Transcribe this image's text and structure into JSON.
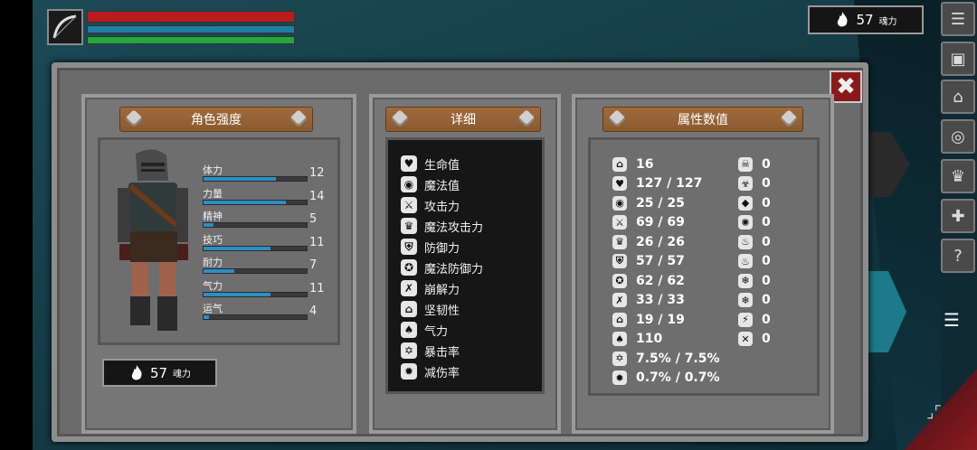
{
  "hud": {
    "souls_top": "57",
    "souls_label": "魂力"
  },
  "panel": {
    "character": {
      "title": "角色强度",
      "stats": [
        {
          "name": "体力",
          "value": "12",
          "fill": 0.7
        },
        {
          "name": "力量",
          "value": "14",
          "fill": 0.8
        },
        {
          "name": "精神",
          "value": "5",
          "fill": 0.1
        },
        {
          "name": "技巧",
          "value": "11",
          "fill": 0.65
        },
        {
          "name": "耐力",
          "value": "7",
          "fill": 0.3
        },
        {
          "name": "气力",
          "value": "11",
          "fill": 0.65
        },
        {
          "name": "运气",
          "value": "4",
          "fill": 0.05
        }
      ],
      "souls": "57",
      "souls_label": "魂力"
    },
    "details": {
      "title": "详细",
      "items": [
        {
          "label": "生命值",
          "icon": "heart-icon",
          "glyph": "♥"
        },
        {
          "label": "魔法值",
          "icon": "brain-icon",
          "glyph": "◉"
        },
        {
          "label": "攻击力",
          "icon": "sword-icon",
          "glyph": "⚔"
        },
        {
          "label": "魔法攻击力",
          "icon": "crown-icon",
          "glyph": "♛"
        },
        {
          "label": "防御力",
          "icon": "shield-icon",
          "glyph": "⛨"
        },
        {
          "label": "魔法防御力",
          "icon": "magic-shield-icon",
          "glyph": "✪"
        },
        {
          "label": "崩解力",
          "icon": "break-icon",
          "glyph": "✗"
        },
        {
          "label": "坚韧性",
          "icon": "helmet-icon",
          "glyph": "⌂"
        },
        {
          "label": "气力",
          "icon": "lungs-icon",
          "glyph": "♠"
        },
        {
          "label": "暴击率",
          "icon": "star-icon",
          "glyph": "✡"
        },
        {
          "label": "减伤率",
          "icon": "badge-icon",
          "glyph": "✹"
        }
      ]
    },
    "attributes": {
      "title": "属性数值",
      "left": [
        {
          "icon": "helmet-icon",
          "glyph": "⌂",
          "value": "16"
        },
        {
          "icon": "heart-icon",
          "glyph": "♥",
          "value": "127 / 127"
        },
        {
          "icon": "brain-icon",
          "glyph": "◉",
          "value": "25 / 25"
        },
        {
          "icon": "sword-icon",
          "glyph": "⚔",
          "value": "69 / 69"
        },
        {
          "icon": "crown-icon",
          "glyph": "♛",
          "value": "26 / 26"
        },
        {
          "icon": "shield-icon",
          "glyph": "⛨",
          "value": "57 / 57"
        },
        {
          "icon": "magic-shield-icon",
          "glyph": "✪",
          "value": "62 / 62"
        },
        {
          "icon": "break-icon",
          "glyph": "✗",
          "value": "33 / 33"
        },
        {
          "icon": "helmet-icon",
          "glyph": "⌂",
          "value": "19 / 19"
        },
        {
          "icon": "lungs-icon",
          "glyph": "♠",
          "value": "110"
        },
        {
          "icon": "star-icon",
          "glyph": "✡",
          "value": "7.5% / 7.5%"
        },
        {
          "icon": "badge-icon",
          "glyph": "✹",
          "value": "0.7% / 0.7%"
        }
      ],
      "right": [
        {
          "icon": "skull-icon",
          "glyph": "☠",
          "value": "0"
        },
        {
          "icon": "poison-icon",
          "glyph": "☣",
          "value": "0"
        },
        {
          "icon": "bleed-icon",
          "glyph": "◆",
          "value": "0"
        },
        {
          "icon": "curse-icon",
          "glyph": "✺",
          "value": "0"
        },
        {
          "icon": "fire-icon",
          "glyph": "♨",
          "value": "0"
        },
        {
          "icon": "fire-resist-icon",
          "glyph": "♨",
          "value": "0"
        },
        {
          "icon": "frost-icon",
          "glyph": "❄",
          "value": "0"
        },
        {
          "icon": "frost-resist-icon",
          "glyph": "❄",
          "value": "0"
        },
        {
          "icon": "lightning-icon",
          "glyph": "⚡",
          "value": "0"
        },
        {
          "icon": "lightning-resist-icon",
          "glyph": "✕",
          "value": "0"
        }
      ]
    }
  },
  "menu": {
    "help_glyph": "?"
  }
}
